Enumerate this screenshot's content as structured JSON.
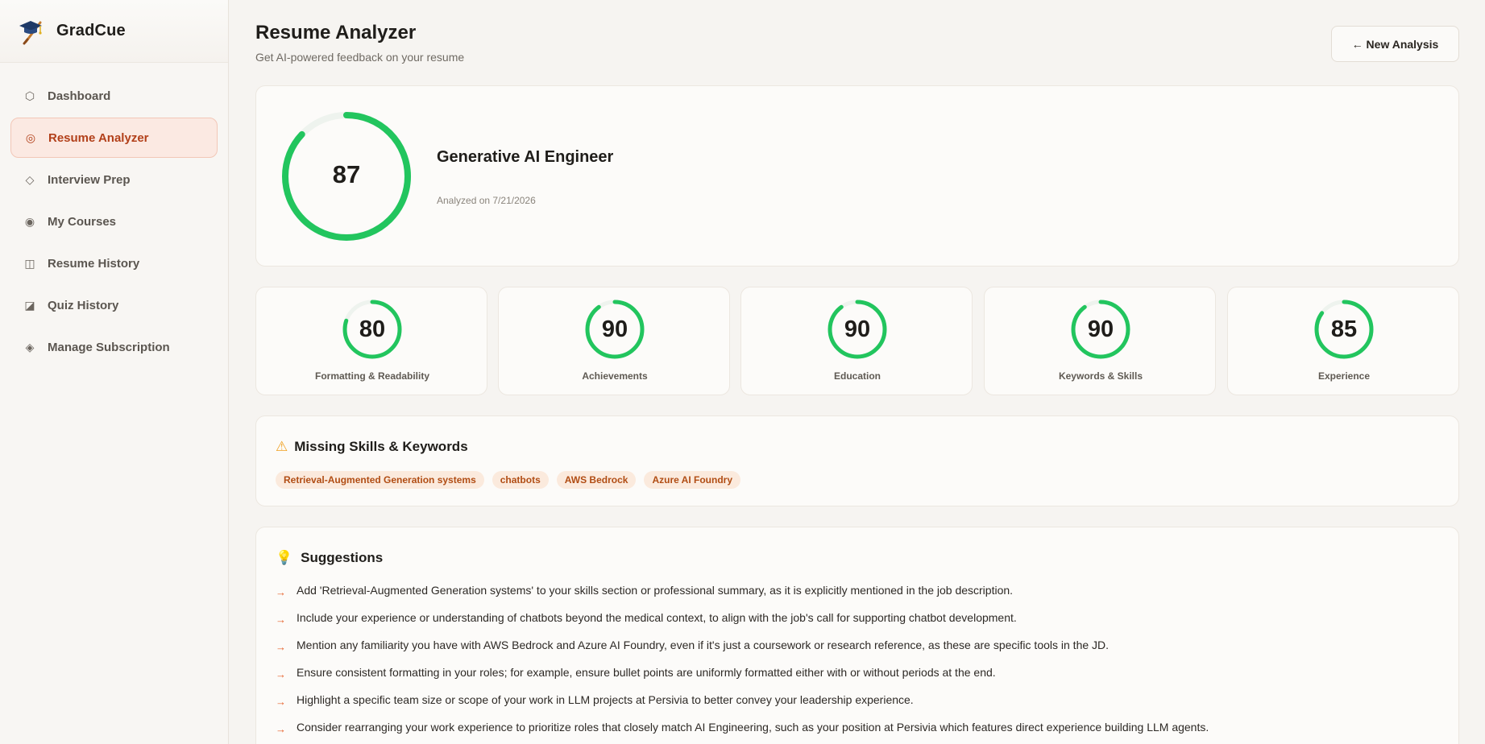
{
  "brand": {
    "name": "GradCue",
    "logo_icon": "graduation-cap-icon"
  },
  "sidebar": {
    "items": [
      {
        "label": "Dashboard",
        "icon": "⬡",
        "icon_name": "hexagon-icon",
        "active": false
      },
      {
        "label": "Resume Analyzer",
        "icon": "◎",
        "icon_name": "target-icon",
        "active": true
      },
      {
        "label": "Interview Prep",
        "icon": "◇",
        "icon_name": "diamond-icon",
        "active": false
      },
      {
        "label": "My Courses",
        "icon": "◉",
        "icon_name": "circle-dot-icon",
        "active": false
      },
      {
        "label": "Resume History",
        "icon": "◫",
        "icon_name": "split-square-icon",
        "active": false
      },
      {
        "label": "Quiz History",
        "icon": "◪",
        "icon_name": "half-square-icon",
        "active": false
      },
      {
        "label": "Manage Subscription",
        "icon": "◈",
        "icon_name": "diamond-dot-icon",
        "active": false
      }
    ]
  },
  "header": {
    "title": "Resume Analyzer",
    "subtitle": "Get AI-powered feedback on your resume",
    "new_analysis_label": "← New Analysis"
  },
  "overall": {
    "score": "87",
    "score_value": 87,
    "job_title": "Generative AI Engineer",
    "analyzed_on": "Analyzed on 7/21/2026"
  },
  "metrics": [
    {
      "label": "Formatting & Readability",
      "value": "80",
      "score": 80
    },
    {
      "label": "Achievements",
      "value": "90",
      "score": 90
    },
    {
      "label": "Education",
      "value": "90",
      "score": 90
    },
    {
      "label": "Keywords & Skills",
      "value": "90",
      "score": 90
    },
    {
      "label": "Experience",
      "value": "85",
      "score": 85
    }
  ],
  "missing": {
    "title": "Missing Skills & Keywords",
    "icon": "⚠",
    "tags": [
      "Retrieval-Augmented Generation systems",
      "chatbots",
      "AWS Bedrock",
      "Azure AI Foundry"
    ]
  },
  "suggestions": {
    "title": "Suggestions",
    "icon": "💡",
    "arrow": "→",
    "items": [
      "Add 'Retrieval-Augmented Generation systems' to your skills section or professional summary, as it is explicitly mentioned in the job description.",
      "Include your experience or understanding of chatbots beyond the medical context, to align with the job's call for supporting chatbot development.",
      "Mention any familiarity you have with AWS Bedrock and Azure AI Foundry, even if it's just a coursework or research reference, as these are specific tools in the JD.",
      "Ensure consistent formatting in your roles; for example, ensure bullet points are uniformly formatted either with or without periods at the end.",
      "Highlight a specific team size or scope of your work in LLM projects at Persivia to better convey your leadership experience.",
      "Consider rearranging your work experience to prioritize roles that closely match AI Engineering, such as your position at Persivia which features direct experience building LLM agents."
    ]
  },
  "colors": {
    "accent": "#b2401a",
    "ring": "#22c55e",
    "ring_track": "#eef3ee",
    "tag_bg": "#fbeadd",
    "tag_text": "#b14d14"
  }
}
